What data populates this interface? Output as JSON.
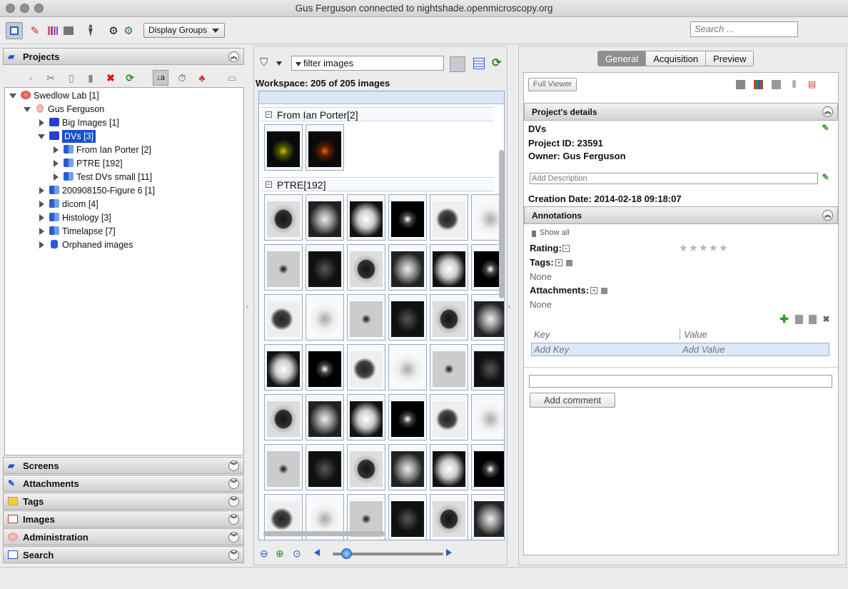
{
  "window": {
    "title": "Gus Ferguson connected to nightshade.openmicroscopy.org"
  },
  "toolbar": {
    "display_groups": "Display Groups",
    "search_placeholder": "Search ..."
  },
  "left": {
    "projects_title": "Projects",
    "tree": [
      {
        "label": "Swedlow Lab [1]"
      },
      {
        "label": "Gus Ferguson"
      },
      {
        "label": "Big Images [1]"
      },
      {
        "label": "DVs [3]"
      },
      {
        "label": "From Ian Porter [2]"
      },
      {
        "label": "PTRE [192]"
      },
      {
        "label": "Test DVs small [11]"
      },
      {
        "label": "200908150-Figure 6 [1]"
      },
      {
        "label": "dicom [4]"
      },
      {
        "label": "Histology [3]"
      },
      {
        "label": "Timelapse [7]"
      },
      {
        "label": "Orphaned images"
      }
    ],
    "sections": [
      "Screens",
      "Attachments",
      "Tags",
      "Images",
      "Administration",
      "Search"
    ]
  },
  "middle": {
    "filter_text": "filter  images",
    "workspace": "Workspace: 205 of 205 images",
    "groups": [
      {
        "title": "From Ian Porter[2]"
      },
      {
        "title": "PTRE[192]"
      }
    ]
  },
  "right": {
    "tabs": [
      "General",
      "Acquisition",
      "Preview"
    ],
    "full_viewer": "Full Viewer",
    "projects_details_title": "Project's details",
    "name": "DVs",
    "project_id": "Project ID: 23591",
    "owner": "Owner: Gus Ferguson",
    "description_placeholder": "Add Description",
    "creation_date": "Creation Date: 2014-02-18 09:18:07",
    "annotations_title": "Annotations",
    "show_all": "Show all",
    "rating_label": "Rating:",
    "rating_value": 0,
    "tags_label": "Tags:",
    "tags_none": "None",
    "attachments_label": "Attachments:",
    "attachments_none": "None",
    "kv_key_header": "Key",
    "kv_value_header": "Value",
    "kv_add_key": "Add Key",
    "kv_add_value": "Add Value",
    "add_comment": "Add comment"
  }
}
